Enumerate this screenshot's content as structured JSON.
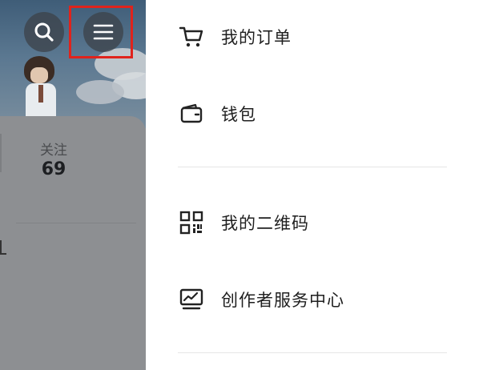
{
  "profile": {
    "follow_label": "关注",
    "follow_count": "69"
  },
  "drawer": {
    "items": [
      {
        "label": "我的订单",
        "icon": "cart-icon"
      },
      {
        "label": "钱包",
        "icon": "wallet-icon"
      },
      {
        "label": "我的二维码",
        "icon": "qr-code-icon"
      },
      {
        "label": "创作者服务中心",
        "icon": "creator-chart-icon"
      }
    ]
  },
  "colors": {
    "highlight": "#e0231c",
    "overlay": "#8e9195",
    "text": "#1f1f1f"
  }
}
